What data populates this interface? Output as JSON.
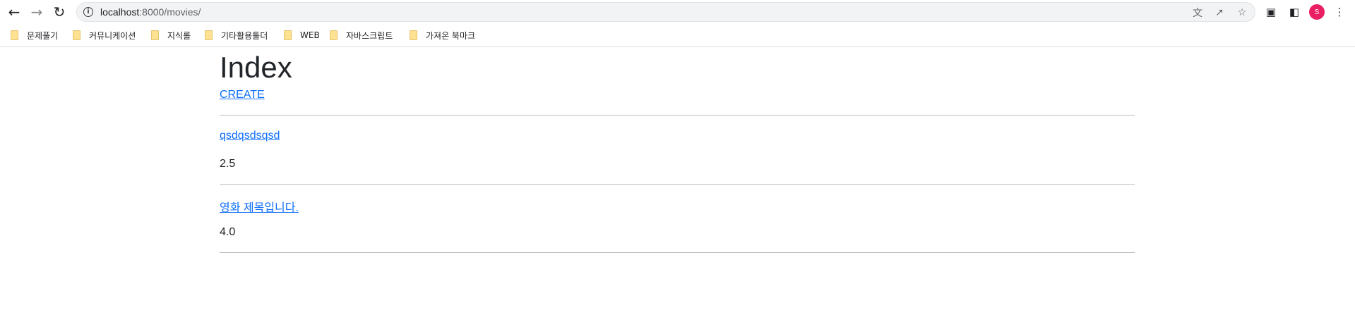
{
  "browser": {
    "url_host": "localhost",
    "url_path": ":8000/movies/",
    "avatar_letter": "S"
  },
  "bookmarks": [
    {
      "label": "문제풀기"
    },
    {
      "label": "커뮤니케이션"
    },
    {
      "label": "지식롤"
    },
    {
      "label": "기타활용툴더"
    },
    {
      "label": "WEB"
    },
    {
      "label": "자바스크립트"
    },
    {
      "label": "가져온 북마크"
    }
  ],
  "page": {
    "title": "Index",
    "create_link": "CREATE"
  },
  "movies": [
    {
      "title": "qsdqsdsqsd",
      "score": "2.5"
    },
    {
      "title": "영화 제목입니다.",
      "score": "4.0"
    }
  ],
  "colors": {
    "link": "#0d6efd",
    "avatar": "#e91e63",
    "bookmark_folder": "#fde293"
  }
}
